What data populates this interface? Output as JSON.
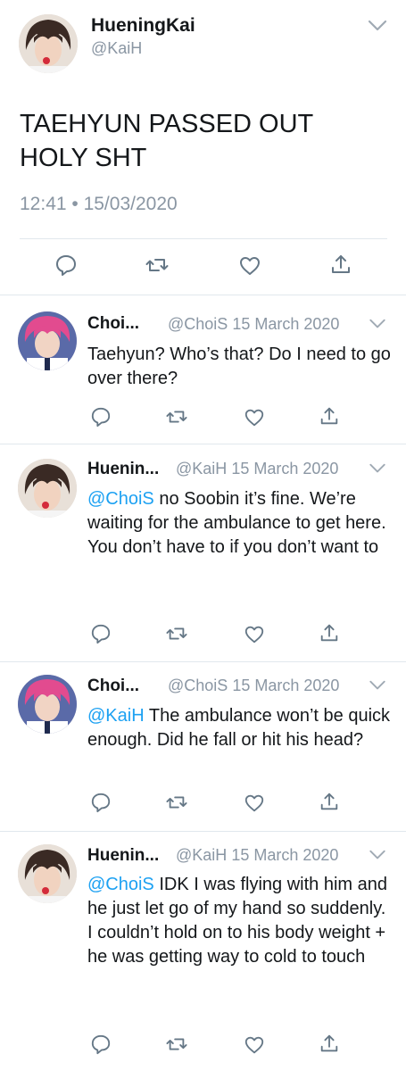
{
  "main": {
    "name": "HueningKai",
    "handle": "@KaiH",
    "text": "TAEHYUN PASSED OUT\nHOLY SHT",
    "timestamp": "12:41 • 15/03/2020",
    "actions": [
      "reply-icon",
      "retweet-icon",
      "like-icon",
      "share-icon"
    ]
  },
  "replies": [
    {
      "name": "Choi...",
      "handle": "@ChoiS",
      "date": "15 March 2020",
      "mention": "",
      "text": "Taehyun? Who’s that? Do I need to go over there?"
    },
    {
      "name": "Huenin...",
      "handle": "@KaiH",
      "date": "15 March 2020",
      "mention": "@ChoiS",
      "text": " no Soobin it’s fine. We’re waiting for the ambulance to get here. You don’t have to if you don’t want to"
    },
    {
      "name": "Choi...",
      "handle": "@ChoiS",
      "date": "15 March 2020",
      "mention": "@KaiH",
      "text": " The ambulance won’t be quick enough. Did he fall or hit his head?"
    },
    {
      "name": "Huenin...",
      "handle": "@KaiH",
      "date": "15 March 2020",
      "mention": "@ChoiS",
      "text": " IDK I was flying with him and he just let go of my hand so suddenly. I couldn’t hold on to his body weight + he was getting way to cold to touch"
    }
  ],
  "colors": {
    "link": "#1da1f2",
    "muted": "#8a96a3",
    "text": "#14171a",
    "divider": "#e1e8ed"
  }
}
